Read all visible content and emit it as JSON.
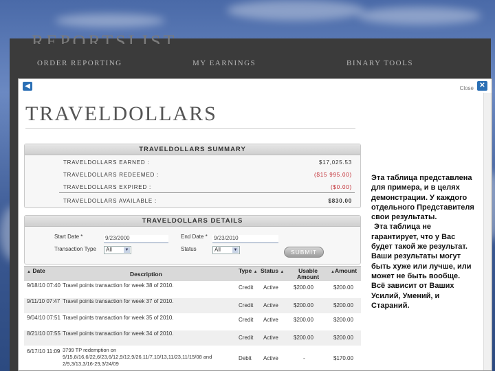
{
  "app": {
    "title": "REPORTSLIST",
    "nav": [
      "ORDER REPORTING",
      "MY EARNINGS",
      "BINARY TOOLS"
    ]
  },
  "modal": {
    "close_label": "Close",
    "back_icon": "back-arrow-icon",
    "close_icon": "close-x-icon",
    "title": "TRAVELDOLLARS"
  },
  "summary": {
    "heading": "TRAVELDOLLARS SUMMARY",
    "rows": [
      {
        "label": "TRAVELDOLLARS EARNED :",
        "amount": "$17,025.53",
        "red": false
      },
      {
        "label": "TRAVELDOLLARS REDEEMED :",
        "amount": "($15 995.00)",
        "red": true
      },
      {
        "label": "TRAVELDOLLARS EXPIRED :",
        "amount": "($0.00)",
        "red": true
      },
      {
        "label": "TRAVELDOLLARS AVAILABLE :",
        "amount": "$830.00",
        "red": false
      }
    ]
  },
  "details": {
    "heading": "TRAVELDOLLARS DETAILS",
    "start_date_label": "Start Date *",
    "start_date_value": "9/23/2000",
    "end_date_label": "End Date *",
    "end_date_value": "9/23/2010",
    "transaction_type_label": "Transaction Type",
    "transaction_type_value": "All",
    "status_label": "Status",
    "status_value": "All",
    "submit_label": "SUBMIT"
  },
  "table": {
    "columns": [
      "Date",
      "Description",
      "Type",
      "Status",
      "Usable Amount",
      "Amount"
    ],
    "rows": [
      {
        "date": "9/18/10 07:40",
        "description": "Travel points transaction for week 38 of 2010.",
        "type": "Credit",
        "status": "Active",
        "usable": "$200.00",
        "amount": "$200.00"
      },
      {
        "date": "9/11/10 07:47",
        "description": "Travel points transaction for week 37 of 2010.",
        "type": "Credit",
        "status": "Active",
        "usable": "$200.00",
        "amount": "$200.00"
      },
      {
        "date": "9/04/10 07:51",
        "description": "Travel points transaction for week 35 of 2010.",
        "type": "Credit",
        "status": "Active",
        "usable": "$200.00",
        "amount": "$200.00"
      },
      {
        "date": "8/21/10 07:55",
        "description": "Travel points transaction for week 34 of 2010.",
        "type": "Credit",
        "status": "Active",
        "usable": "$200.00",
        "amount": "$200.00"
      },
      {
        "date": "6/17/10 11:09",
        "description": "3799 TP redemption on 9/15,8/16,6/22,6/23,6/12,9/12,9/26,11/7,10/13,11/23,11/15/08 and 2/9,3/13,3/16-29,3/24/09",
        "type": "Debit",
        "status": "Active",
        "usable": "-",
        "amount": "$170.00"
      }
    ]
  },
  "slide_text": {
    "p1": "Эта таблица представлена для примера, и в целях демонстрации. У каждого отдельного Представителя свои результаты.",
    "p2": "Эта таблица не гарантирует, что у Вас будет такой же результат. Ваши результаты могут быть хуже или лучше, или может не быть вообще. Всё зависит от Ваших Усилий, Умений, и Стараний."
  }
}
